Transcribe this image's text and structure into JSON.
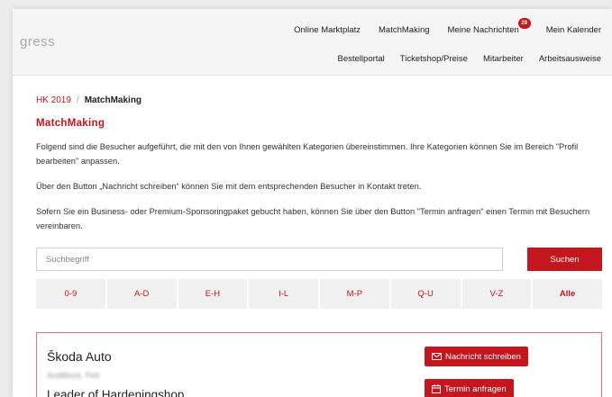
{
  "header": {
    "logo_text": "gress",
    "nav_top": [
      {
        "label": "Online Marktplatz"
      },
      {
        "label": "MatchMaking"
      },
      {
        "label": "Meine Nachrichten",
        "badge": "29"
      },
      {
        "label": "Mein Kalender"
      }
    ],
    "nav_bottom": [
      {
        "label": "Bestellportal"
      },
      {
        "label": "Ticketshop/Preise"
      },
      {
        "label": "Mitarbeiter"
      },
      {
        "label": "Arbeitsausweise"
      }
    ]
  },
  "breadcrumb": {
    "home": "HK 2019",
    "separator": "/",
    "current": "MatchMaking"
  },
  "title": "MatchMaking",
  "paragraphs": [
    "Folgend sind die Besucher aufgeführt, die mit den von Ihnen gewählten Kategorien übereinstimmen. Ihre Kategorien können Sie im Bereich \"Profil bearbeiten\" anpassen.",
    "Über den Button „Nachricht schreiben“ können Sie mit dem entsprechenden Besucher in Kontakt treten.",
    "Sofern Sie ein Business- oder Premium-Sponsoringpaket gebucht haben, können Sie über den Button \"Termin anfragen\" einen Termin mit Besuchern vereinbaren."
  ],
  "search": {
    "placeholder": "Suchbegriff",
    "value": "",
    "button_label": "Suchen"
  },
  "alphabet_filter": [
    "0-9",
    "A-D",
    "E-H",
    "I-L",
    "M-P",
    "Q-U",
    "V-Z",
    "Alle"
  ],
  "result": {
    "company": "Škoda Auto",
    "contact": "Andělová, Petr",
    "role": "Leader of Hardeningshop",
    "message_button": "Nachricht schreiben",
    "appointment_button": "Termin anfragen"
  },
  "colors": {
    "accent": "#c5161d",
    "filter_bg": "#f1f1f1",
    "header_bg": "#f5f5f5"
  },
  "icons": {
    "message_button": "envelope-icon",
    "appointment_button": "calendar-icon"
  }
}
